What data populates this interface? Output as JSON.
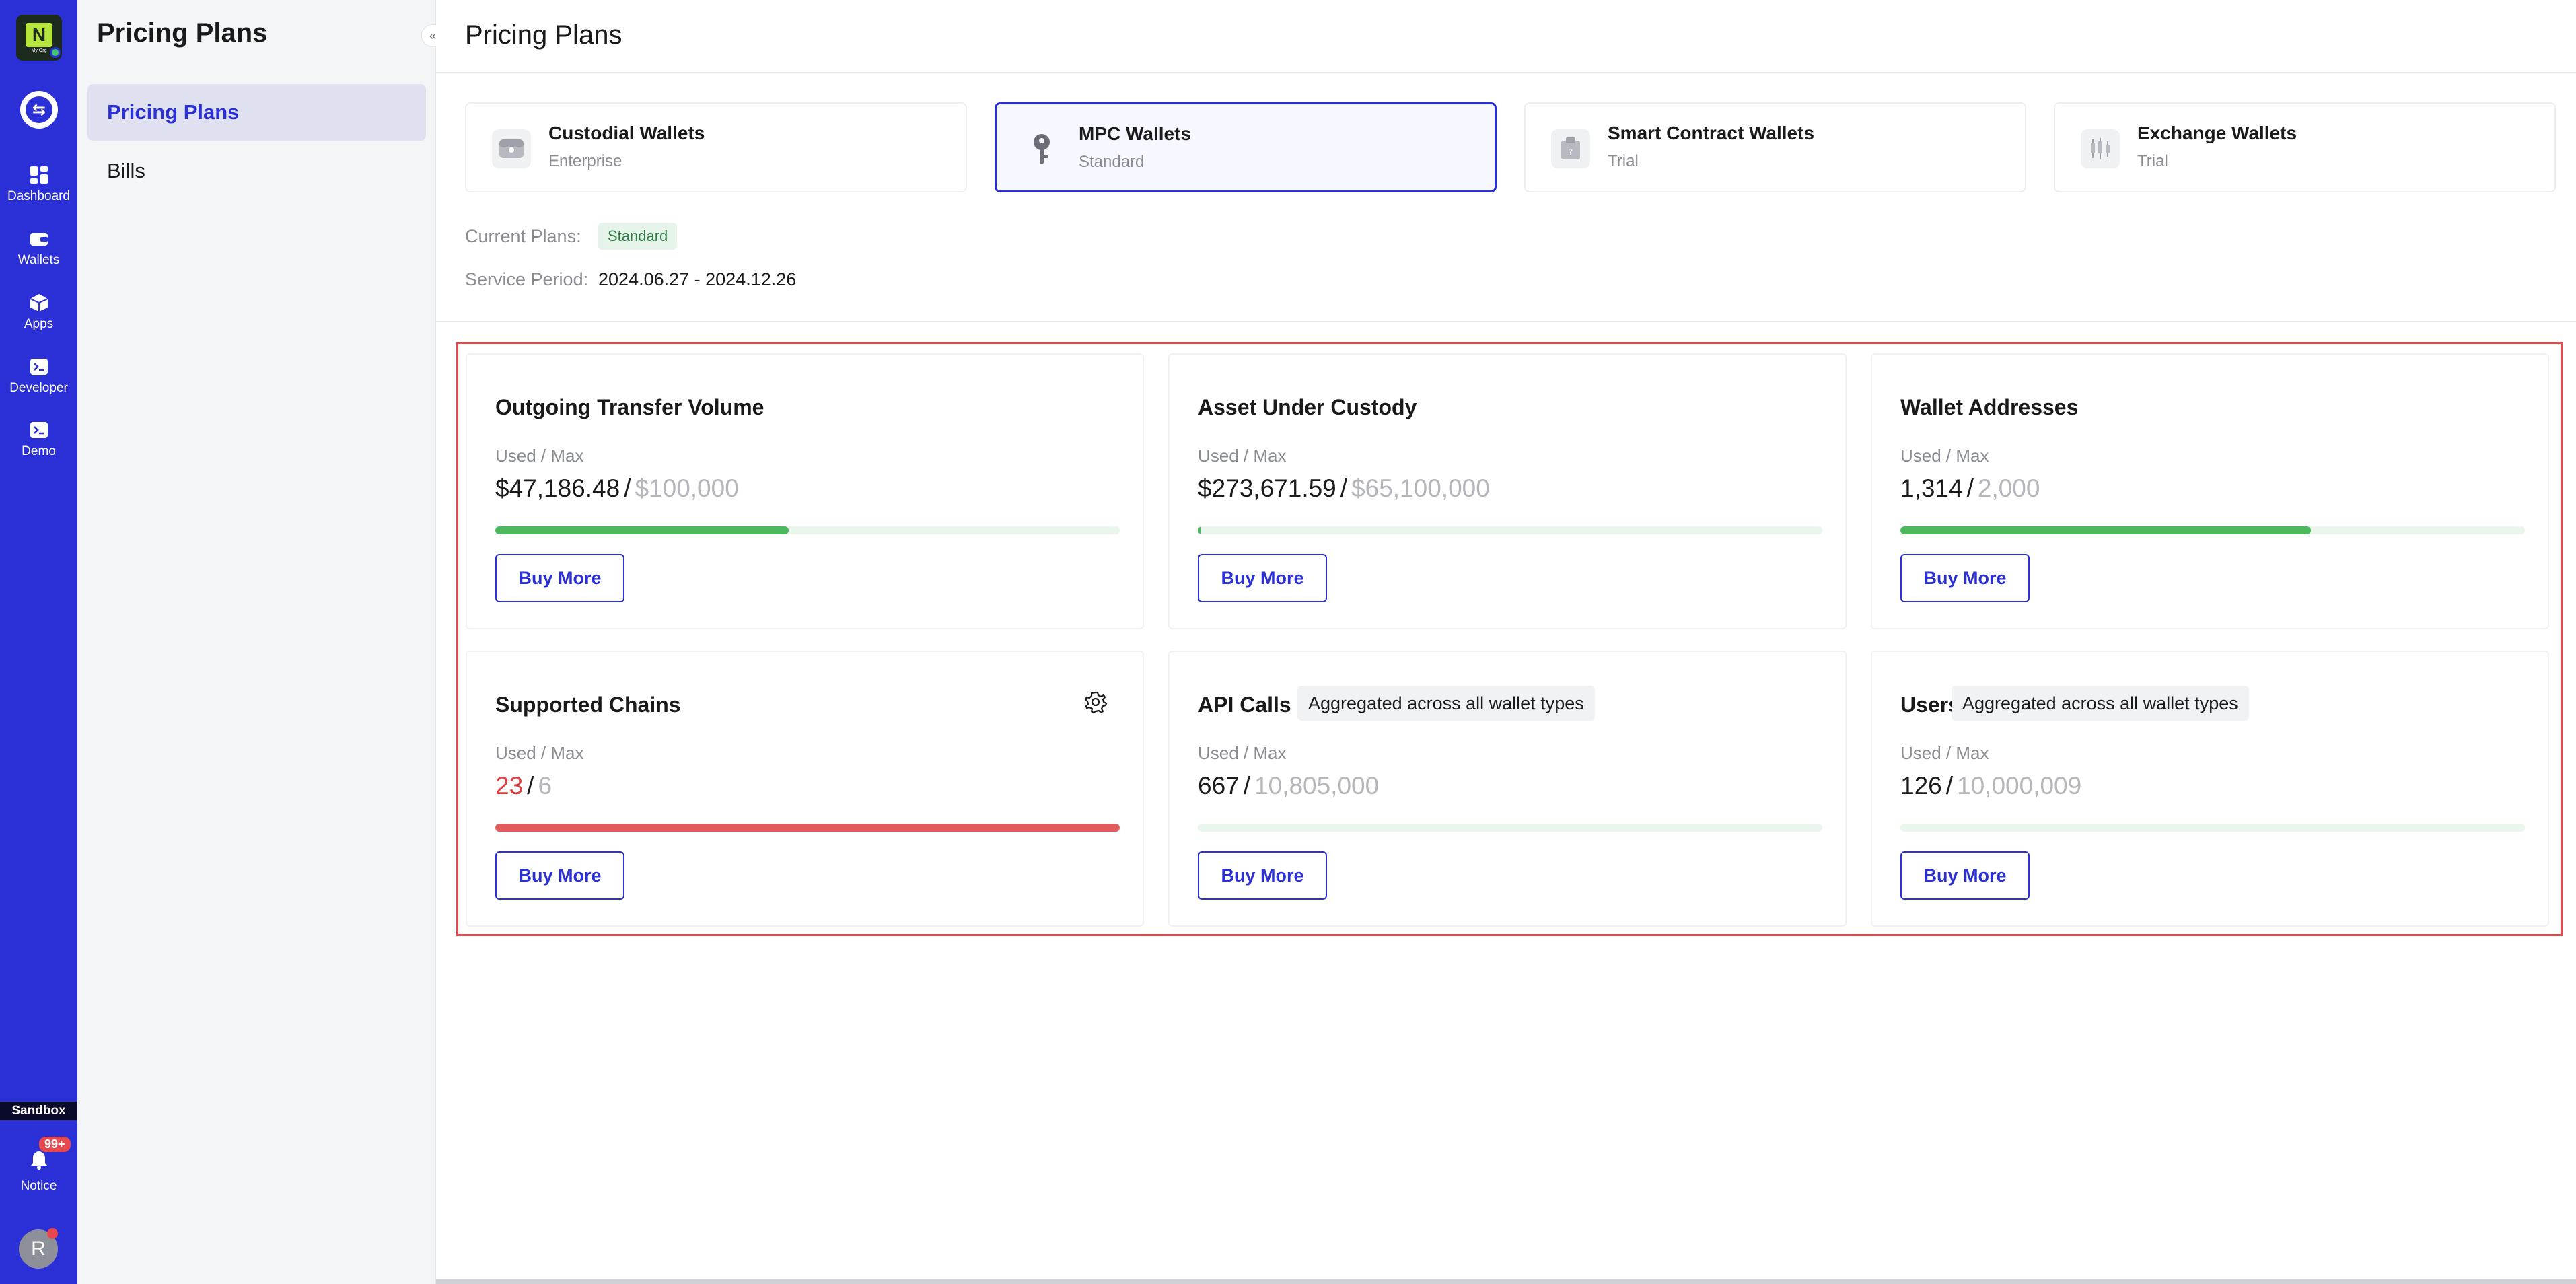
{
  "rail": {
    "org_logo_text": "N",
    "org_logo_sub": "My Org",
    "items": [
      {
        "label": "Dashboard",
        "icon": "dashboard-icon"
      },
      {
        "label": "Wallets",
        "icon": "wallet-icon"
      },
      {
        "label": "Apps",
        "icon": "cube-icon"
      },
      {
        "label": "Developer",
        "icon": "terminal-icon"
      },
      {
        "label": "Demo",
        "icon": "terminal-icon"
      }
    ],
    "sandbox_label": "Sandbox",
    "notice_label": "Notice",
    "notice_badge": "99+",
    "avatar_initial": "R"
  },
  "sidebar": {
    "title": "Pricing Plans",
    "items": [
      {
        "label": "Pricing Plans",
        "active": true
      },
      {
        "label": "Bills",
        "active": false
      }
    ]
  },
  "main": {
    "title": "Pricing Plans",
    "wallets": [
      {
        "name": "Custodial Wallets",
        "tier": "Enterprise",
        "icon": "custodial-wallet-icon",
        "active": false
      },
      {
        "name": "MPC Wallets",
        "tier": "Standard",
        "icon": "key-icon",
        "active": true
      },
      {
        "name": "Smart Contract Wallets",
        "tier": "Trial",
        "icon": "contract-icon",
        "active": false
      },
      {
        "name": "Exchange Wallets",
        "tier": "Trial",
        "icon": "candlestick-icon",
        "active": false
      }
    ],
    "current_plans_label": "Current Plans:",
    "current_plan": "Standard",
    "service_period_label": "Service Period:",
    "service_period": "2024.06.27 - 2024.12.26",
    "used_max_label": "Used / Max",
    "buy_more_label": "Buy More",
    "metrics": [
      {
        "title": "Outgoing Transfer Volume",
        "used": "$47,186.48",
        "max": "$100,000",
        "progress": 0.47,
        "over": false,
        "tag": ""
      },
      {
        "title": "Asset Under Custody",
        "used": "$273,671.59",
        "max": "$65,100,000",
        "progress": 0.004,
        "over": false,
        "tag": ""
      },
      {
        "title": "Wallet Addresses",
        "used": "1,314",
        "max": "2,000",
        "progress": 0.657,
        "over": false,
        "tag": ""
      },
      {
        "title": "Supported Chains",
        "used": "23",
        "max": "6",
        "progress": 1.0,
        "over": true,
        "tag": ""
      },
      {
        "title": "API Calls",
        "used": "667",
        "max": "10,805,000",
        "progress": 0.0,
        "over": false,
        "tag": "Aggregated across all wallet types"
      },
      {
        "title": "Users",
        "used": "126",
        "max": "10,000,009",
        "progress": 0.0,
        "over": false,
        "tag": "Aggregated across all wallet types"
      }
    ]
  },
  "colors": {
    "brand": "#2a2fd6",
    "progress_ok": "#4cba5c",
    "progress_over": "#e05c5c",
    "highlight_border": "#e5484d"
  }
}
